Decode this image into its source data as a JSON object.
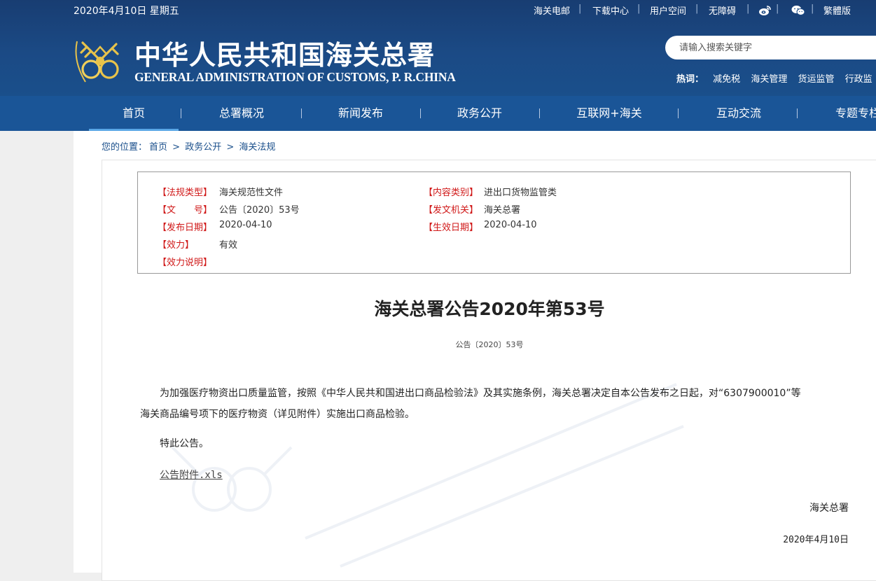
{
  "header": {
    "date": "2020年4月10日 星期五",
    "top_links": [
      "海关电邮",
      "下载中心",
      "用户空间",
      "无障碍"
    ],
    "traditional_label": "繁體版",
    "title": "中华人民共和国海关总署",
    "subtitle": "GENERAL ADMINISTRATION OF CUSTOMS, P. R.CHINA",
    "search_placeholder": "请输入搜索关键字",
    "hot_label": "热词：",
    "hot_words": [
      "减免税",
      "海关管理",
      "货运监管",
      "行政监"
    ]
  },
  "nav": {
    "items": [
      "首页",
      "总署概况",
      "新闻发布",
      "政务公开",
      "互联网+海关",
      "互动交流",
      "专题专栏"
    ],
    "active_index": 0
  },
  "breadcrumb": {
    "prefix": "您的位置：",
    "items": [
      "首页",
      "政务公开",
      "海关法规"
    ],
    "separator": ">"
  },
  "meta": {
    "left": [
      {
        "key": "【法规类型】",
        "value": "海关规范性文件"
      },
      {
        "key": "【文　　号】",
        "value": "公告〔2020〕53号"
      },
      {
        "key": "【发布日期】",
        "value": "2020-04-10"
      },
      {
        "key": "【效力】",
        "value": "有效"
      },
      {
        "key": "【效力说明】",
        "value": ""
      }
    ],
    "right": [
      {
        "key": "【内容类别】",
        "value": "进出口货物监管类"
      },
      {
        "key": "【发文机关】",
        "value": "海关总署"
      },
      {
        "key": "【生效日期】",
        "value": "2020-04-10"
      }
    ]
  },
  "article": {
    "title": "海关总署公告2020年第53号",
    "number": "公告〔2020〕53号",
    "body": "为加强医疗物资出口质量监管，按照《中华人民共和国进出口商品检验法》及其实施条例，海关总署决定自本公告发布之日起，对“6307900010”等海关商品编号项下的医疗物资（详见附件）实施出口商品检验。",
    "closing": "特此公告。",
    "attachment": "公告附件.xls",
    "signature": "海关总署",
    "sign_date": "2020年4月10日"
  },
  "colors": {
    "header_bg": "#1b4a85",
    "nav_bg": "#1a5597",
    "meta_key": "#d01818",
    "link": "#1a4f8b"
  }
}
